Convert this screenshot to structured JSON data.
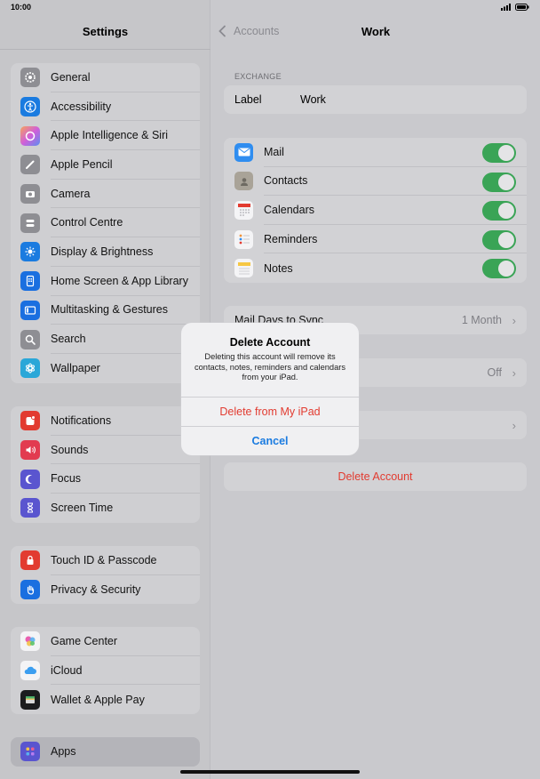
{
  "status": {
    "time": "10:00"
  },
  "sidebar": {
    "title": "Settings",
    "groups": [
      {
        "items": [
          {
            "label": "General",
            "icon": "gear-icon",
            "color": "#8e8e93"
          },
          {
            "label": "Accessibility",
            "icon": "accessibility-icon",
            "color": "#1a7be0"
          },
          {
            "label": "Apple Intelligence & Siri",
            "icon": "siri-icon",
            "color": "#c86ad9"
          },
          {
            "label": "Apple Pencil",
            "icon": "pencil-icon",
            "color": "#8e8e93"
          },
          {
            "label": "Camera",
            "icon": "camera-icon",
            "color": "#8e8e93"
          },
          {
            "label": "Control Centre",
            "icon": "control-centre-icon",
            "color": "#8e8e93"
          },
          {
            "label": "Display & Brightness",
            "icon": "brightness-icon",
            "color": "#1a7be0"
          },
          {
            "label": "Home Screen & App Library",
            "icon": "home-screen-icon",
            "color": "#1a6fe0"
          },
          {
            "label": "Multitasking & Gestures",
            "icon": "multitasking-icon",
            "color": "#1a6fe0"
          },
          {
            "label": "Search",
            "icon": "search-icon",
            "color": "#8e8e93"
          },
          {
            "label": "Wallpaper",
            "icon": "wallpaper-icon",
            "color": "#2aa7d8"
          }
        ]
      },
      {
        "items": [
          {
            "label": "Notifications",
            "icon": "notifications-icon",
            "color": "#e23b30"
          },
          {
            "label": "Sounds",
            "icon": "sounds-icon",
            "color": "#e23b50"
          },
          {
            "label": "Focus",
            "icon": "moon-icon",
            "color": "#5a55cf"
          },
          {
            "label": "Screen Time",
            "icon": "hourglass-icon",
            "color": "#5a55cf"
          }
        ]
      },
      {
        "items": [
          {
            "label": "Touch ID & Passcode",
            "icon": "fingerprint-icon",
            "color": "#e23b30"
          },
          {
            "label": "Privacy & Security",
            "icon": "hand-icon",
            "color": "#1a6fe0"
          }
        ]
      },
      {
        "items": [
          {
            "label": "Game Center",
            "icon": "game-center-icon",
            "color": "#ffffff"
          },
          {
            "label": "iCloud",
            "icon": "cloud-icon",
            "color": "#ffffff"
          },
          {
            "label": "Wallet & Apple Pay",
            "icon": "wallet-icon",
            "color": "#1c1c1e"
          }
        ]
      },
      {
        "items": [
          {
            "label": "Apps",
            "icon": "apps-icon",
            "color": "#5a55cf"
          }
        ]
      }
    ]
  },
  "detail": {
    "back_label": "Accounts",
    "title": "Work",
    "section_exchange": "EXCHANGE",
    "label_key": "Label",
    "label_value": "Work",
    "services": [
      {
        "label": "Mail",
        "icon": "mail-icon",
        "on": true
      },
      {
        "label": "Contacts",
        "icon": "contacts-icon",
        "on": true
      },
      {
        "label": "Calendars",
        "icon": "calendars-icon",
        "on": true
      },
      {
        "label": "Reminders",
        "icon": "reminders-icon",
        "on": true
      },
      {
        "label": "Notes",
        "icon": "notes-icon",
        "on": true
      }
    ],
    "mail_days_label": "Mail Days to Sync",
    "mail_days_value": "1 Month",
    "auto_reply_value": "Off",
    "delete_account": "Delete Account"
  },
  "alert": {
    "title": "Delete Account",
    "message": "Deleting this account will remove its contacts, notes, reminders and calendars from your iPad.",
    "destructive_label": "Delete from My iPad",
    "cancel_label": "Cancel"
  },
  "colors": {
    "accent": "#1a7be0",
    "destructive": "#e23b30",
    "toggle_on": "#3aa456"
  }
}
